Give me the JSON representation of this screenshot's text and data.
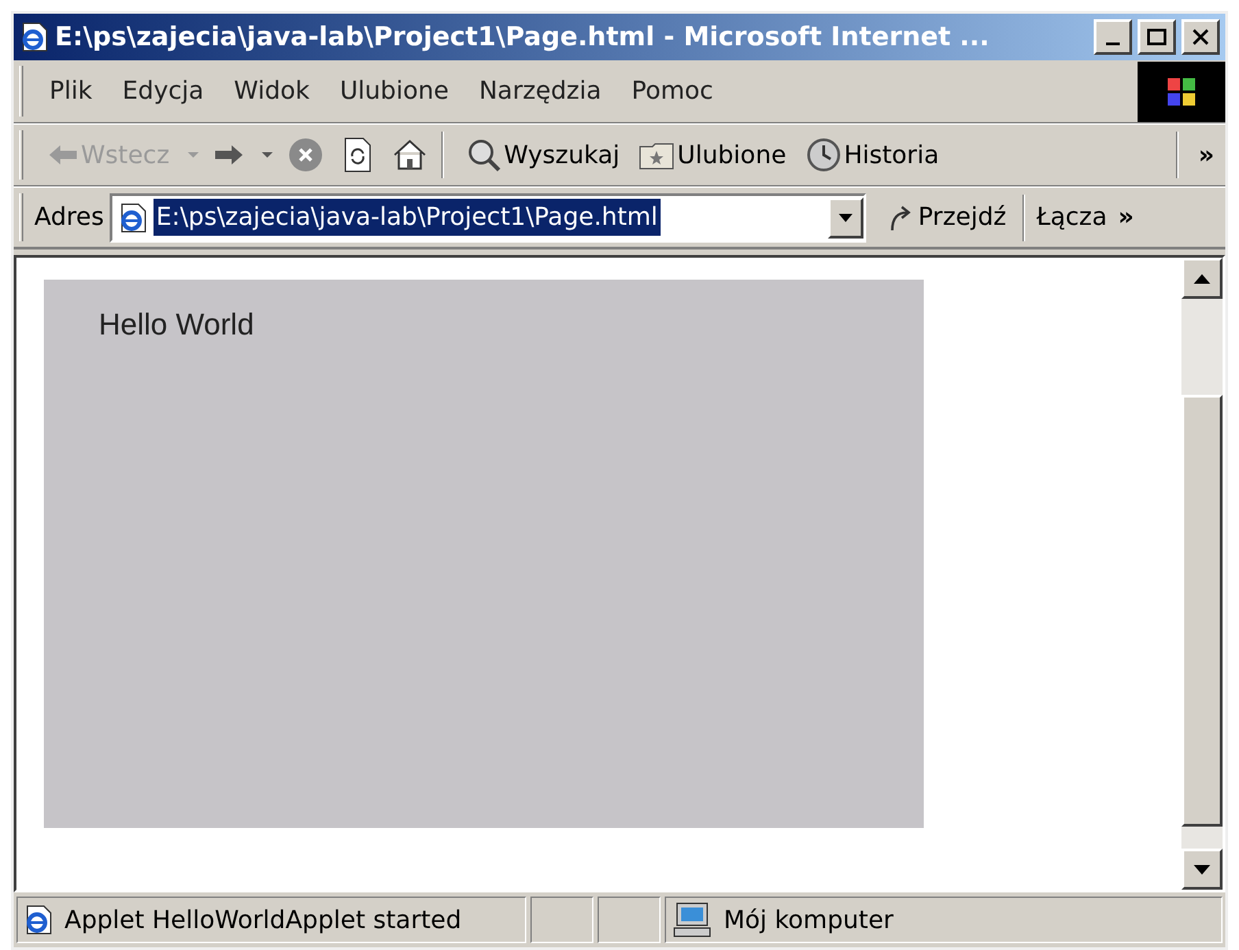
{
  "window": {
    "title": "E:\\ps\\zajecia\\java-lab\\Project1\\Page.html - Microsoft Internet ..."
  },
  "menu": [
    {
      "label": "Plik"
    },
    {
      "label": "Edycja"
    },
    {
      "label": "Widok"
    },
    {
      "label": "Ulubione"
    },
    {
      "label": "Narzędzia"
    },
    {
      "label": "Pomoc"
    }
  ],
  "toolbar": [
    {
      "kind": "back",
      "label": "Wstecz",
      "disabled": true
    },
    {
      "kind": "forward",
      "disabled": false
    },
    {
      "kind": "stop"
    },
    {
      "kind": "refresh"
    },
    {
      "kind": "home"
    },
    {
      "kind": "search",
      "label": "Wyszukaj"
    },
    {
      "kind": "favorites",
      "label": "Ulubione"
    },
    {
      "kind": "history",
      "label": "Historia"
    }
  ],
  "toolbar_more": "»",
  "address": {
    "label": "Adres",
    "value": "E:\\ps\\zajecia\\java-lab\\Project1\\Page.html",
    "go": "Przejdź",
    "links": "Łącza",
    "links_more": "»"
  },
  "applet": {
    "text": "Hello World"
  },
  "status_bar": {
    "message": "Applet HelloWorldApplet started",
    "zone": "Mój komputer"
  }
}
